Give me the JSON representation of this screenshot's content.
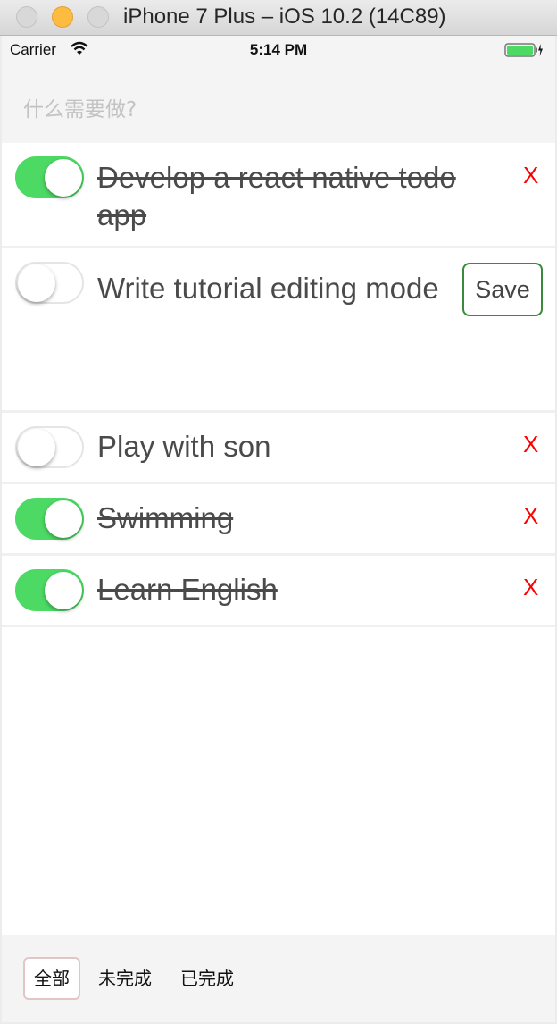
{
  "window": {
    "title": "iPhone 7 Plus – iOS 10.2 (14C89)"
  },
  "status_bar": {
    "carrier": "Carrier",
    "time": "5:14 PM",
    "battery_color": "#4cd964"
  },
  "input": {
    "placeholder": "什么需要做?",
    "value": ""
  },
  "todos": [
    {
      "text": "Develop a react native todo app",
      "completed": true,
      "action": "X"
    },
    {
      "text": "Write tutorial editing mode",
      "completed": false,
      "action": "Save",
      "editing": true
    },
    {
      "text": "Play with son",
      "completed": false,
      "action": "X"
    },
    {
      "text": "Swimming",
      "completed": true,
      "action": "X"
    },
    {
      "text": "Learn English",
      "completed": true,
      "action": "X"
    }
  ],
  "filters": [
    {
      "label": "全部",
      "active": true
    },
    {
      "label": "未完成",
      "active": false
    },
    {
      "label": "已完成",
      "active": false
    }
  ],
  "colors": {
    "switch_on": "#4cd964",
    "delete": "#ff0000",
    "save_border": "#3a8a3a"
  }
}
